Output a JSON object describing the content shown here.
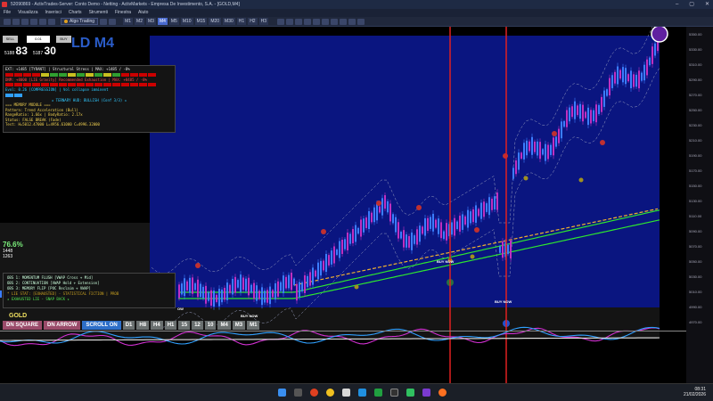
{
  "window": {
    "title": "52090869 - ActivTrades-Server: Conto Demo - Netting - ActivMarkets - Empresa De Investimento, S.A. - [GOLD,M4]"
  },
  "menu": [
    "File",
    "Visualizza",
    "Inserisci",
    "Charts",
    "Strumenti",
    "Finestra",
    "Aiuto"
  ],
  "toolbar": {
    "algo_label": "Algo Trading",
    "timeframes": [
      "M1",
      "M2",
      "M3",
      "M4",
      "M5",
      "M10",
      "M15",
      "M20",
      "M30",
      "H1",
      "H2",
      "H3"
    ],
    "active_timeframe": "M4"
  },
  "trade_panel": {
    "sell_label": "SELL",
    "buy_label": "BUY",
    "volume": "0.01",
    "sell_price_prefix": "5188",
    "sell_price_big": "83",
    "buy_price_prefix": "5187",
    "buy_price_big": "30"
  },
  "chart_title": "LD M4",
  "hud": {
    "line1": "EXT: +1485 [TYRANT] | Structural Stress | MAX: +1485 / -8%",
    "line2": "DNM: +8000 [LIE Gravity] Recommended Exhaustion | MAX: +8485 / -8%",
    "line3": "Evol: 0.26 [COMPRESSION] | Vol collapse imminent",
    "line4": "★ TERNARY HUD: BULLISH (Conf 3/3) ★",
    "line5": "=== MEMORY MODULE ===",
    "line6": "Pattern: Trend Acceleration (Bull)",
    "line7": "RangeRatio: 1.66x | BodyRatio: 2.17x",
    "line8": "Status: FALSE BREAK (Fade)",
    "line9": "Test: H=5012.47000 L=4956.61000 C=4996.32000"
  },
  "left_stats": {
    "percent": "76.6%",
    "value1": "1448",
    "value2": "1263"
  },
  "obs": {
    "line1": "OBS 1: MOMENTUM FLUSH [VWAP Cross + Mid]",
    "line2": "OBS 2: CONTINUATION [VWAP Hold + Extension]",
    "line3": "OBS 3: MEMORY FLIP [POC Reclaim + VWAP]",
    "line4": "* LIE STAT: [EXHAUSTED] - STATISTICAL FICTION | PROB",
    "line5": "★ EXHAUSTED LIE - SNAP BACK ★"
  },
  "signals": [
    "BUY NOW",
    "BUY NOW",
    "BUY NOW",
    "OW"
  ],
  "bottom_symbol": "GOLD",
  "bottom_buttons": [
    "DN SQUARE",
    "DN ARROW",
    "SCROLL ON",
    "D1",
    "H8",
    "H4",
    "H1",
    "15",
    "12",
    "10",
    "M4",
    "M3",
    "M1"
  ],
  "price_scale": [
    "5350.00",
    "5330.00",
    "5310.00",
    "5290.00",
    "5270.00",
    "5250.00",
    "5230.00",
    "5210.00",
    "5190.00",
    "5170.00",
    "5150.00",
    "5130.00",
    "5110.00",
    "5090.00",
    "5070.00",
    "5050.00",
    "5030.00",
    "5010.00",
    "4990.00",
    "4970.00"
  ],
  "clock": {
    "time": "08:31",
    "date": "21/02/2026"
  },
  "colors": {
    "chart_bg": "#0a1580",
    "candle": "#3b7dff",
    "signal_line": "#e02020",
    "ma_green": "#2ee82e",
    "ma_orange": "#f0b030"
  }
}
